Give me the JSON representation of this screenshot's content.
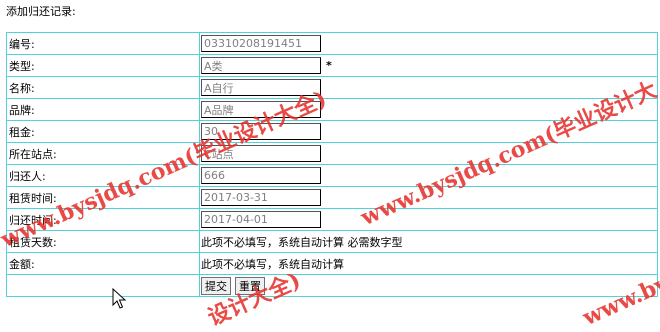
{
  "page": {
    "heading": "添加归还记录:"
  },
  "form": {
    "rows": [
      {
        "label": "编号:",
        "value": "03310208191451",
        "required": true
      },
      {
        "label": "类型:",
        "value": "A类",
        "required": true
      },
      {
        "label": "名称:",
        "value": "A自行"
      },
      {
        "label": "品牌:",
        "value": "A品牌"
      },
      {
        "label": "租金:",
        "value": "30"
      },
      {
        "label": "所在站点:",
        "value": "C站点"
      },
      {
        "label": "归还人:",
        "value": "666"
      },
      {
        "label": "租赁时间:",
        "value": "2017-03-31"
      },
      {
        "label": "归还时间:",
        "value": "2017-04-01"
      },
      {
        "label": "租赁天数:",
        "note": "此项不必填写，系统自动计算 必需数字型"
      },
      {
        "label": "金额:",
        "note": "此项不必填写，系统自动计算"
      }
    ],
    "required_mark": "*",
    "submit_label": "提交",
    "reset_label": "重置"
  },
  "watermark": {
    "line1": "www.bysjdq.com(毕业设计大全)",
    "line2": "www.bysjdq.com(毕业设计大",
    "line3": "设计大全)",
    "line4": "www.bysjdq.com(毕业设计大全)",
    "color": "#e8322d"
  },
  "colors": {
    "table_border": "#4fd2da",
    "input_text": "#808080"
  }
}
